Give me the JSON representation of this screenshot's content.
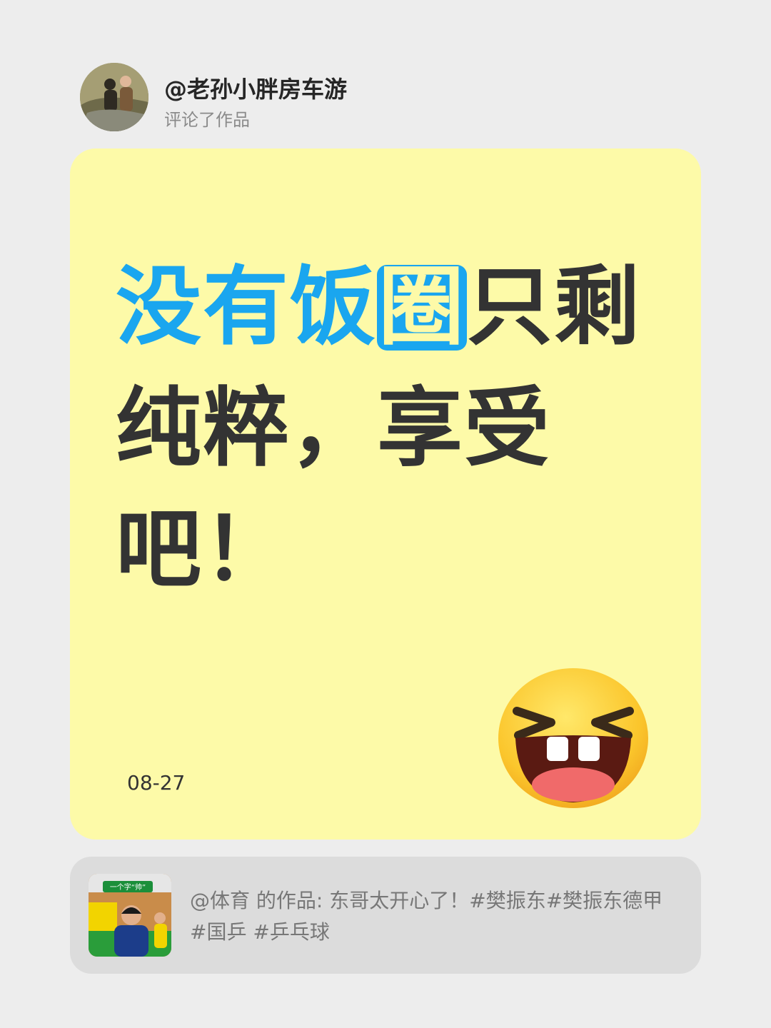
{
  "header": {
    "username": "@老孙小胖房车游",
    "action": "评论了作品",
    "avatar_icon": "user-avatar"
  },
  "comment_card": {
    "text_line1_blue": "没有饭",
    "text_line1_boxed": "圈",
    "text_line1_rest": "只剩",
    "text_line2": "纯粹，享受",
    "text_line3": "吧！",
    "date": "08-27",
    "emoji_icon": "laughing-face-icon",
    "background_color": "#fdfaa8",
    "accent_color": "#1aa6ef"
  },
  "source_work": {
    "thumbnail_caption": "一个字“帅”",
    "text": "@体育 的作品: 东哥太开心了！#樊振东#樊振东德甲 #国乒 #乒乓球"
  }
}
